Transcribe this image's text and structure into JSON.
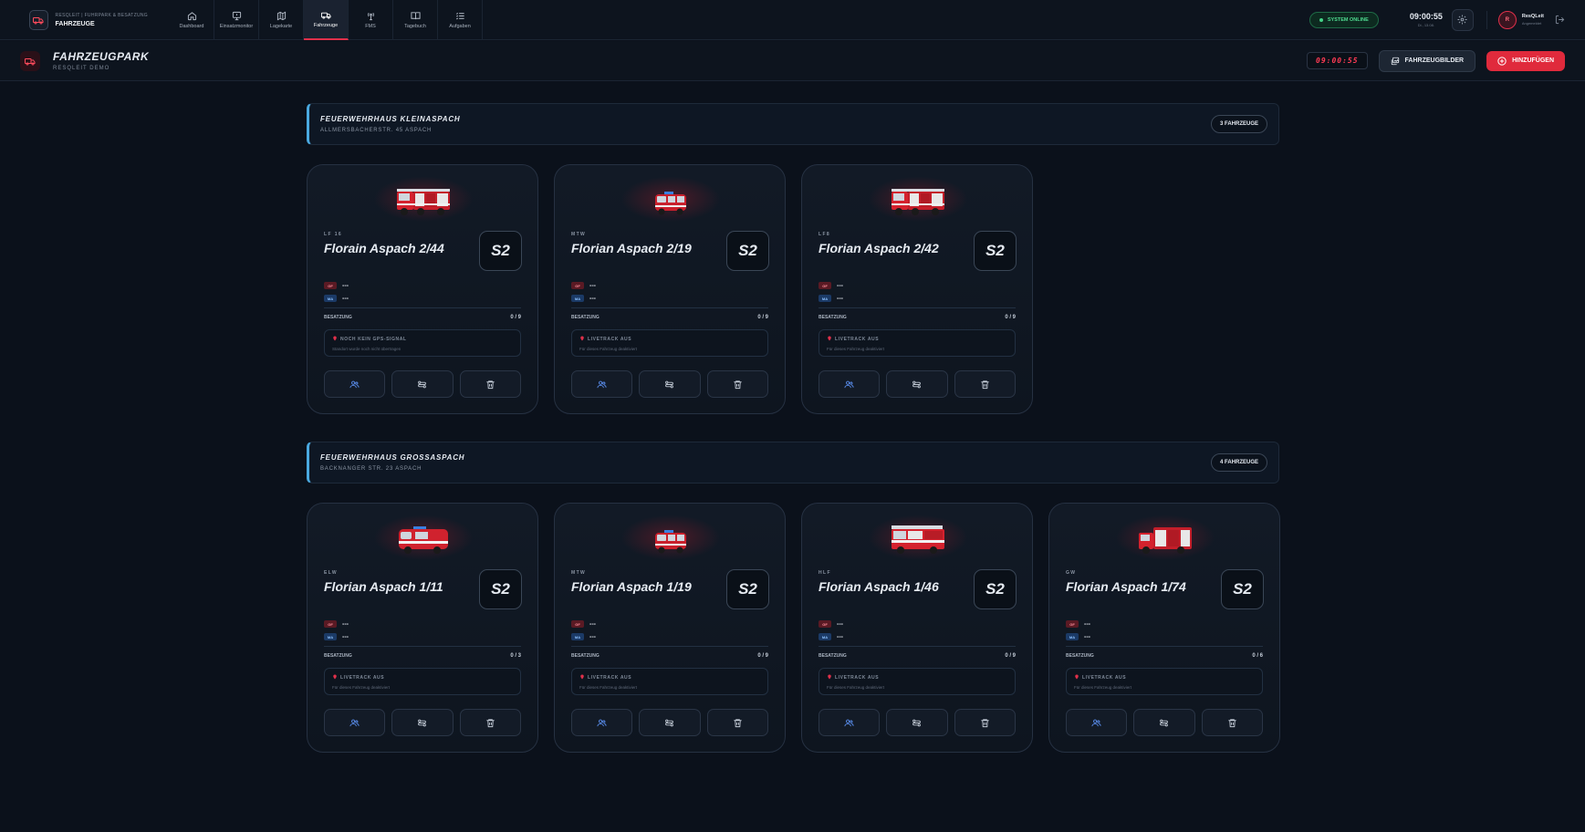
{
  "header": {
    "brand_sub": "RESQLEIT | FUHRPARK & BESATZUNG",
    "brand_title": "FAHRZEUGE",
    "nav": [
      "Dashboard",
      "Einsatzmonitor",
      "Lagekarte",
      "Fahrzeuge",
      "FMS",
      "Tagebuch",
      "Aufgaben"
    ],
    "system_status": "SYSTEM ONLINE",
    "time": "09:00:55",
    "date": "Di., 13.08.",
    "user_initial": "R",
    "user_name": "ResQLeit",
    "user_role": "Angemeldet"
  },
  "subheader": {
    "title": "FAHRZEUGPARK",
    "subtitle": "RESQLEIT DEMO",
    "clock": "09:00:55",
    "images_button": "FAHRZEUGBILDER",
    "add_button": "HINZUFÜGEN"
  },
  "labels": {
    "gf_tag": "GF",
    "ma_tag": "MA",
    "crew_label": "BESATZUNG"
  },
  "stations": [
    {
      "name": "FEUERWEHRHAUS KLEINASPACH",
      "address": "ALLMERSBACHERSTR. 45 ASPACH",
      "count": "3 FAHRZEUGE",
      "vehicles": [
        {
          "type": "LF 16",
          "name": "Florain Aspach 2/44",
          "status": "S2",
          "gf": "---",
          "ma": "---",
          "crew": "0 / 9",
          "gps_title": "NOCH KEIN GPS-SIGNAL",
          "gps_text": "Standort wurde noch nicht übertragen",
          "icon": "lf-truck-icon"
        },
        {
          "type": "MTW",
          "name": "Florian Aspach 2/19",
          "status": "S2",
          "gf": "---",
          "ma": "---",
          "crew": "0 / 9",
          "gps_title": "LIVETRACK AUS",
          "gps_text": "Für dieses Fahrzeug deaktiviert",
          "icon": "van-icon"
        },
        {
          "type": "LF8",
          "name": "Florian Aspach 2/42",
          "status": "S2",
          "gf": "---",
          "ma": "---",
          "crew": "0 / 9",
          "gps_title": "LIVETRACK AUS",
          "gps_text": "Für dieses Fahrzeug deaktiviert",
          "icon": "lf-truck-icon"
        }
      ]
    },
    {
      "name": "FEUERWEHRHAUS GROSSASPACH",
      "address": "BACKNANGER STR. 23 ASPACH",
      "count": "4 FAHRZEUGE",
      "vehicles": [
        {
          "type": "ELW",
          "name": "Florian Aspach 1/11",
          "status": "S2",
          "gf": "---",
          "ma": "---",
          "crew": "0 / 3",
          "gps_title": "LIVETRACK AUS",
          "gps_text": "Für dieses Fahrzeug deaktiviert",
          "icon": "elw-van-icon"
        },
        {
          "type": "MTW",
          "name": "Florian Aspach 1/19",
          "status": "S2",
          "gf": "---",
          "ma": "---",
          "crew": "0 / 9",
          "gps_title": "LIVETRACK AUS",
          "gps_text": "Für dieses Fahrzeug deaktiviert",
          "icon": "van-icon"
        },
        {
          "type": "HLF",
          "name": "Florian Aspach 1/46",
          "status": "S2",
          "gf": "---",
          "ma": "---",
          "crew": "0 / 9",
          "gps_title": "LIVETRACK AUS",
          "gps_text": "Für dieses Fahrzeug deaktiviert",
          "icon": "hlf-truck-icon"
        },
        {
          "type": "GW",
          "name": "Florian Aspach 1/74",
          "status": "S2",
          "gf": "---",
          "ma": "---",
          "crew": "0 / 6",
          "gps_title": "LIVETRACK AUS",
          "gps_text": "Für dieses Fahrzeug deaktiviert",
          "icon": "gw-truck-icon"
        }
      ]
    }
  ],
  "colors": {
    "accent_red": "#e02a3c",
    "status_green": "#44d387",
    "station_accent": "#4aa9e0",
    "background": "#0b111b"
  }
}
